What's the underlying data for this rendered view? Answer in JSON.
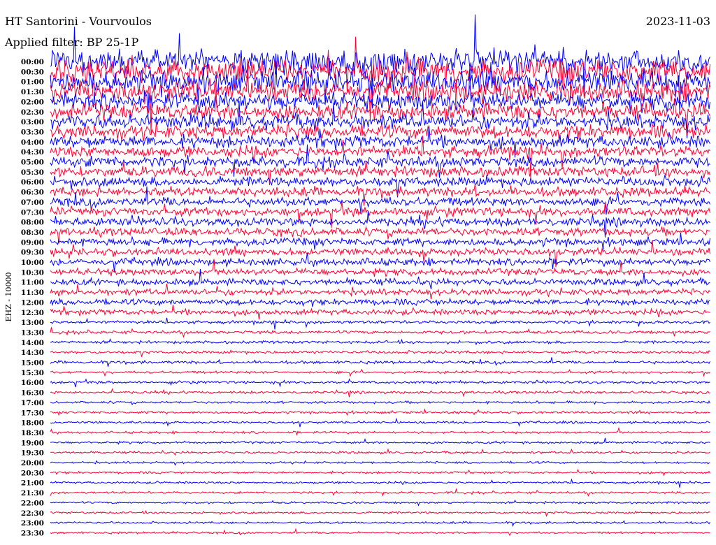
{
  "header": {
    "station": "HT Santorini - Vourvoulos",
    "date": "2023-11-03",
    "filter": "Applied filter: BP 25-1P"
  },
  "chart_data": {
    "type": "line",
    "title": "HT Santorini - Vourvoulos",
    "subtitle": "Applied filter: BP 25-1P",
    "ylabel": "EHZ - 10000",
    "y_tick_labels": [
      "00:00",
      "00:30",
      "01:00",
      "01:30",
      "02:00",
      "02:30",
      "03:00",
      "03:30",
      "04:00",
      "04:30",
      "05:00",
      "05:30",
      "06:00",
      "06:30",
      "07:00",
      "07:30",
      "08:00",
      "08:30",
      "09:00",
      "09:30",
      "10:00",
      "10:30",
      "11:00",
      "11:30",
      "12:00",
      "12:30",
      "13:00",
      "13:30",
      "14:00",
      "14:30",
      "15:00",
      "15:30",
      "16:00",
      "16:30",
      "17:00",
      "17:30",
      "18:00",
      "18:30",
      "19:00",
      "19:30",
      "20:00",
      "20:30",
      "21:00",
      "21:30",
      "22:00",
      "22:30",
      "23:00",
      "23:30"
    ],
    "series_colors": [
      "#0000ff",
      "#ff0033"
    ],
    "row_amplitude_relative": [
      4.5,
      4.3,
      4.0,
      3.6,
      3.2,
      2.8,
      2.6,
      2.4,
      2.2,
      2.0,
      1.9,
      1.8,
      1.7,
      1.6,
      1.55,
      1.5,
      1.45,
      1.4,
      1.35,
      1.3,
      1.25,
      1.2,
      1.15,
      1.1,
      1.05,
      1.0,
      0.55,
      0.55,
      0.5,
      0.5,
      0.5,
      0.45,
      0.45,
      0.45,
      0.42,
      0.42,
      0.4,
      0.4,
      0.4,
      0.4,
      0.38,
      0.38,
      0.38,
      0.38,
      0.36,
      0.36,
      0.36,
      0.36
    ],
    "grid": false,
    "legend": "none"
  }
}
